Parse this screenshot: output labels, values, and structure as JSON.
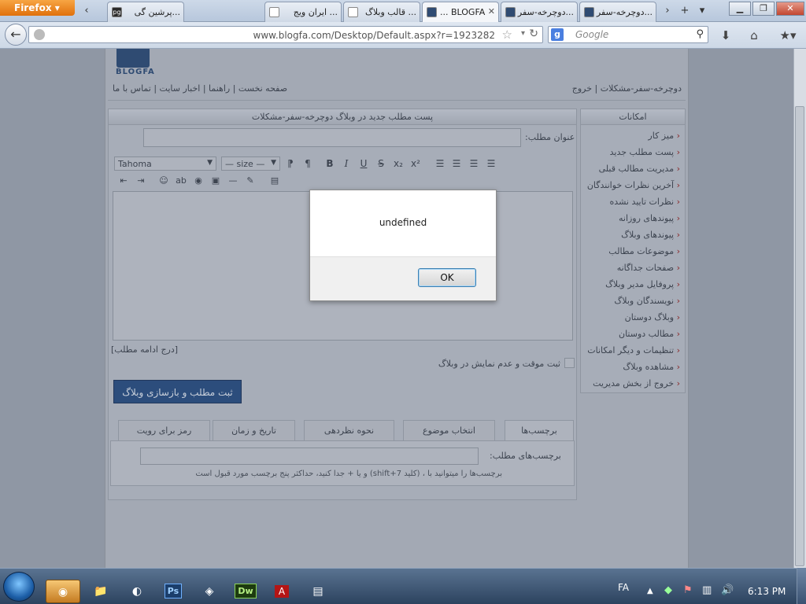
{
  "browser": {
    "app_button": "Firefox",
    "tabs": [
      {
        "label": "...پرشین گی",
        "active": false
      },
      {
        "label": "... ایران ویج",
        "active": false
      },
      {
        "label": "... قالب وبلاگ",
        "active": false
      },
      {
        "label": "... BLOGFA",
        "active": true
      },
      {
        "label": "...دوچرخه-سفر",
        "active": false
      },
      {
        "label": "...دوچرخه-سفر",
        "active": false
      }
    ],
    "url": "www.blogfa.com/Desktop/Default.aspx?r=1923282",
    "search_placeholder": "Google",
    "search_engine_badge": "g"
  },
  "site": {
    "logo_text": "BLOGFA",
    "header_left_links": "صفحه نخست | راهنما | اخبار سایت | تماس با ما",
    "header_right": "دوچرخه-سفر-مشکلات | خروج"
  },
  "sidebar": {
    "title": "امکانات",
    "items": [
      "میز کار",
      "پست مطلب جدید",
      "مدیریت مطالب قبلی",
      "آخرین نظرات خوانندگان",
      "نظرات تایید نشده",
      "پیوندهای روزانه",
      "پیوندهای وبلاگ",
      "موضوعات مطالب",
      "صفحات جداگانه",
      "پروفایل مدیر وبلاگ",
      "نویسندگان وبلاگ",
      "وبلاگ دوستان",
      "مطالب دوستان",
      "تنظیمات و دیگر امکانات",
      "مشاهده وبلاگ",
      "خروج از بخش مدیریت"
    ]
  },
  "editor": {
    "panel_title": "پست مطلب جدید در وبلاگ دوچرخه-سفر-مشکلات",
    "title_label": "عنوان مطلب:",
    "font_select": "Tahoma",
    "size_select": "— size —",
    "continue_link": "[درج ادامه مطلب]",
    "draft_checkbox_label": "ثبت موقت و عدم نمایش در وبلاگ",
    "submit_button": "ثبت مطلب و بازسازی وبلاگ"
  },
  "bottom_tabs": [
    {
      "label": "برچسب‌ها",
      "active": true
    },
    {
      "label": "انتخاب موضوع",
      "active": false
    },
    {
      "label": "نحوه نظردهی",
      "active": false
    },
    {
      "label": "تاریخ و زمان",
      "active": false
    },
    {
      "label": "رمز برای رویت",
      "active": false
    }
  ],
  "tags": {
    "label": "برچسب‌های مطلب:",
    "hint": "برچسب‌ها را میتوانید با ، (کلید shift+7) و یا + جدا کنید، حداکثر پنج برچسب مورد قبول است"
  },
  "dialog": {
    "message": "undefined",
    "ok_button": "OK"
  },
  "taskbar": {
    "language": "FA",
    "clock": "6:13 PM"
  }
}
